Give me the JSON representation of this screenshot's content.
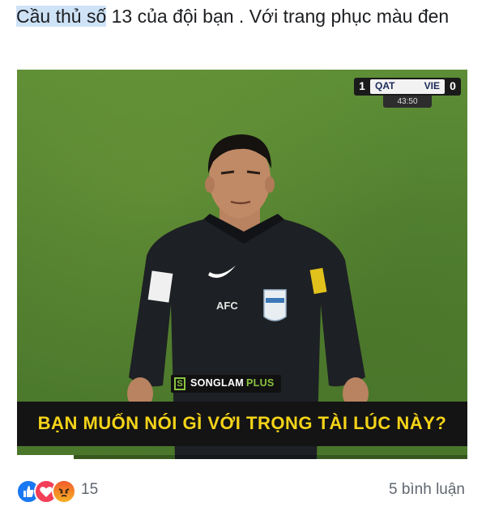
{
  "post": {
    "text_highlight": "Cầu thủ số",
    "text_rest": " 13 của đội bạn . Với trang phục màu đen"
  },
  "video": {
    "scorebug": {
      "home_team": "QAT",
      "home_score": "1",
      "away_team": "VIE",
      "away_score": "0",
      "clock": "43:50"
    },
    "watermark": {
      "icon_letter": "S",
      "name": "SONGLAM",
      "suffix": "PLUS"
    },
    "sleeve_badge": "AFC",
    "caption": "BẠN MUỐN NÓI GÌ VỚI TRỌNG TÀI LÚC NÀY?",
    "progress_fraction": 0.125
  },
  "footer": {
    "reactions": [
      "like-icon",
      "love-icon",
      "angry-icon"
    ],
    "reaction_count": "15",
    "comments": "5 bình luận"
  },
  "colors": {
    "caption_text": "#f5d418",
    "brand_green": "#8bc53f",
    "like_blue": "#1877f2",
    "love_red": "#f33e58",
    "pitch_green": "#517f2f"
  }
}
